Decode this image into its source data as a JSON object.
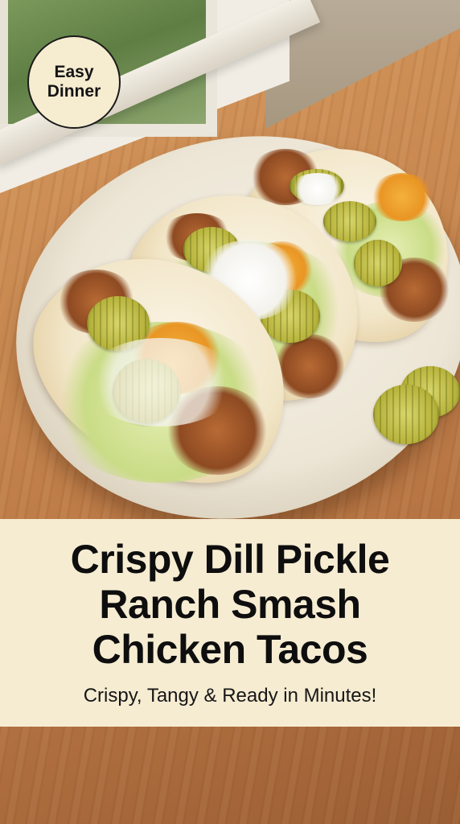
{
  "badge": {
    "line1": "Easy",
    "line2": "Dinner"
  },
  "banner": {
    "title_lines": [
      "Crispy Dill Pickle",
      "Ranch Smash",
      "Chicken Tacos"
    ],
    "subtitle": "Crispy, Tangy & Ready in Minutes!"
  },
  "colors": {
    "banner_background": "#f6ecd2",
    "badge_background": "#f6ecd0",
    "text": "#0e0e0e"
  }
}
